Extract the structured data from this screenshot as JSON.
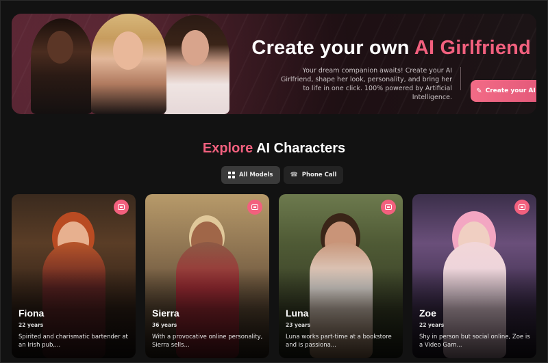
{
  "hero": {
    "title_prefix": "Create your own",
    "title_accent": "AI Girlfriend",
    "description": "Your dream companion awaits! Create your AI Girlfriend, shape her look, personality, and bring her to life in one click. 100% powered by Artificial Intelligence.",
    "cta_label": "Create your AI",
    "cta_icon": "magic-wand-icon"
  },
  "explore": {
    "title_accent": "Explore",
    "title_rest": "AI Characters",
    "filters": [
      {
        "label": "All Models",
        "icon": "grid-icon",
        "active": true
      },
      {
        "label": "Phone Call",
        "icon": "phone-icon",
        "active": false
      }
    ]
  },
  "characters": [
    {
      "name": "Fiona",
      "age": "22 years",
      "description": "Spirited and charismatic bartender at an Irish pub,..."
    },
    {
      "name": "Sierra",
      "age": "36 years",
      "description": "With a provocative online personality, Sierra sells..."
    },
    {
      "name": "Luna",
      "age": "23 years",
      "description": "Luna works part-time at a bookstore and is passiona..."
    },
    {
      "name": "Zoe",
      "age": "22 years",
      "description": "Shy in person but social online, Zoe is a Video Gam..."
    }
  ],
  "colors": {
    "accent": "#f2607e",
    "background": "#121212"
  }
}
